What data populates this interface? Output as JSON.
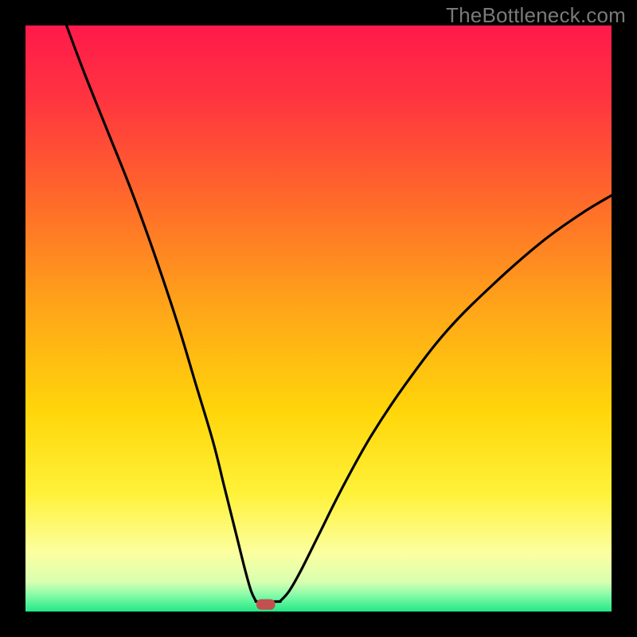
{
  "watermark": "TheBottleneck.com",
  "colors": {
    "frame": "#000000",
    "curve": "#000000",
    "marker": "#c1504f",
    "gradient_stops": [
      {
        "pos": 0.0,
        "color": "#ff1a4b"
      },
      {
        "pos": 0.12,
        "color": "#ff3340"
      },
      {
        "pos": 0.3,
        "color": "#ff6a2a"
      },
      {
        "pos": 0.48,
        "color": "#ffa519"
      },
      {
        "pos": 0.66,
        "color": "#ffd60a"
      },
      {
        "pos": 0.8,
        "color": "#fff23a"
      },
      {
        "pos": 0.9,
        "color": "#fcffa0"
      },
      {
        "pos": 0.95,
        "color": "#d7ffb0"
      },
      {
        "pos": 0.97,
        "color": "#8dfcaa"
      },
      {
        "pos": 1.0,
        "color": "#23e887"
      }
    ]
  },
  "chart_data": {
    "type": "line",
    "x_range": [
      0,
      100
    ],
    "y_range": [
      0,
      100
    ],
    "optimal_x": 40,
    "marker": {
      "x": 41,
      "y": 1.2,
      "w": 3.2,
      "h": 1.8
    },
    "left_curve": [
      {
        "x": 7,
        "y": 100
      },
      {
        "x": 10,
        "y": 92
      },
      {
        "x": 14,
        "y": 82
      },
      {
        "x": 18,
        "y": 72
      },
      {
        "x": 22,
        "y": 61
      },
      {
        "x": 26,
        "y": 49
      },
      {
        "x": 29,
        "y": 39
      },
      {
        "x": 32,
        "y": 29
      },
      {
        "x": 34,
        "y": 21
      },
      {
        "x": 36,
        "y": 13
      },
      {
        "x": 37.5,
        "y": 7
      },
      {
        "x": 38.5,
        "y": 3.5
      },
      {
        "x": 39.3,
        "y": 1.8
      }
    ],
    "flat_segment": [
      {
        "x": 39.3,
        "y": 1.7
      },
      {
        "x": 43.5,
        "y": 1.7
      }
    ],
    "right_curve": [
      {
        "x": 43.5,
        "y": 1.8
      },
      {
        "x": 45,
        "y": 3.5
      },
      {
        "x": 47,
        "y": 7
      },
      {
        "x": 50,
        "y": 13
      },
      {
        "x": 54,
        "y": 21
      },
      {
        "x": 59,
        "y": 30
      },
      {
        "x": 65,
        "y": 39
      },
      {
        "x": 72,
        "y": 48
      },
      {
        "x": 80,
        "y": 56
      },
      {
        "x": 88,
        "y": 63
      },
      {
        "x": 95,
        "y": 68
      },
      {
        "x": 100,
        "y": 71
      }
    ]
  }
}
